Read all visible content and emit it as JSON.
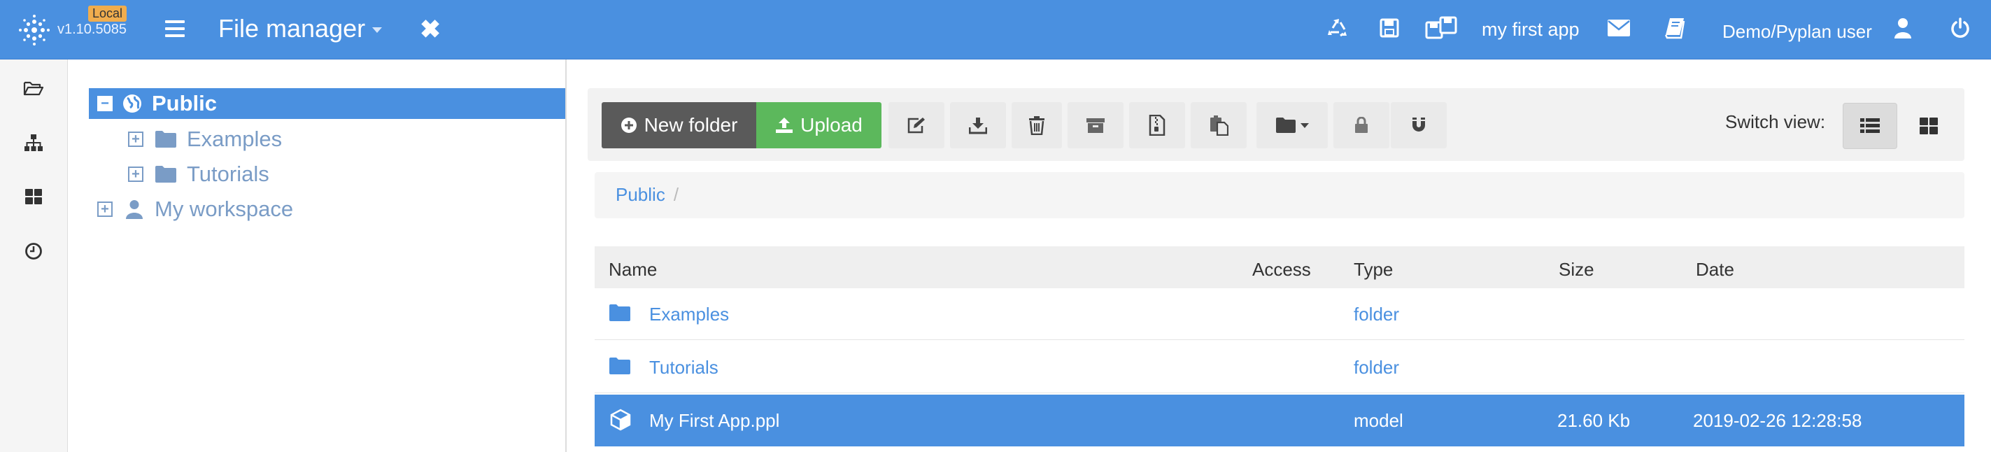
{
  "header": {
    "version": "v1.10.5085",
    "env_badge": "Local",
    "title": "File manager",
    "app_name": "my first app",
    "user_name": "Demo/Pyplan user"
  },
  "tree": {
    "root": "Public",
    "children": [
      "Examples",
      "Tutorials"
    ],
    "workspace": "My workspace"
  },
  "toolbar": {
    "new_folder": "New folder",
    "upload": "Upload",
    "switch_view": "Switch view:"
  },
  "breadcrumb": {
    "items": [
      "Public"
    ],
    "separator": "/"
  },
  "table": {
    "columns": [
      "Name",
      "Access",
      "Type",
      "Size",
      "Date"
    ],
    "rows": [
      {
        "name": "Examples",
        "access": "",
        "type": "folder",
        "size": "",
        "date": ""
      },
      {
        "name": "Tutorials",
        "access": "",
        "type": "folder",
        "size": "",
        "date": ""
      },
      {
        "name": "My First App.ppl",
        "access": "",
        "type": "model",
        "size": "21.60 Kb",
        "date": "2019-02-26 12:28:58"
      }
    ]
  },
  "colors": {
    "header": "#4a90e0",
    "accent": "#4a90e0",
    "upload": "#5cb85c",
    "new_folder": "#5a5a5a",
    "badge": "#f0ad4e"
  },
  "icons": {
    "header": [
      "logo-icon",
      "menu-icon",
      "close-icon",
      "recycle-icon",
      "save-icon",
      "save-as-icon",
      "envelope-icon",
      "book-icon",
      "user-icon",
      "power-icon"
    ],
    "sidebar": [
      "folder-open-icon",
      "sitemap-icon",
      "dashboard-icon",
      "clock-icon"
    ],
    "toolbar": [
      "edit-icon",
      "download-icon",
      "trash-icon",
      "archive-icon",
      "zip-icon",
      "paste-icon",
      "folder-dropdown-icon",
      "lock-icon",
      "magnet-icon",
      "list-view-icon",
      "grid-view-icon"
    ]
  }
}
